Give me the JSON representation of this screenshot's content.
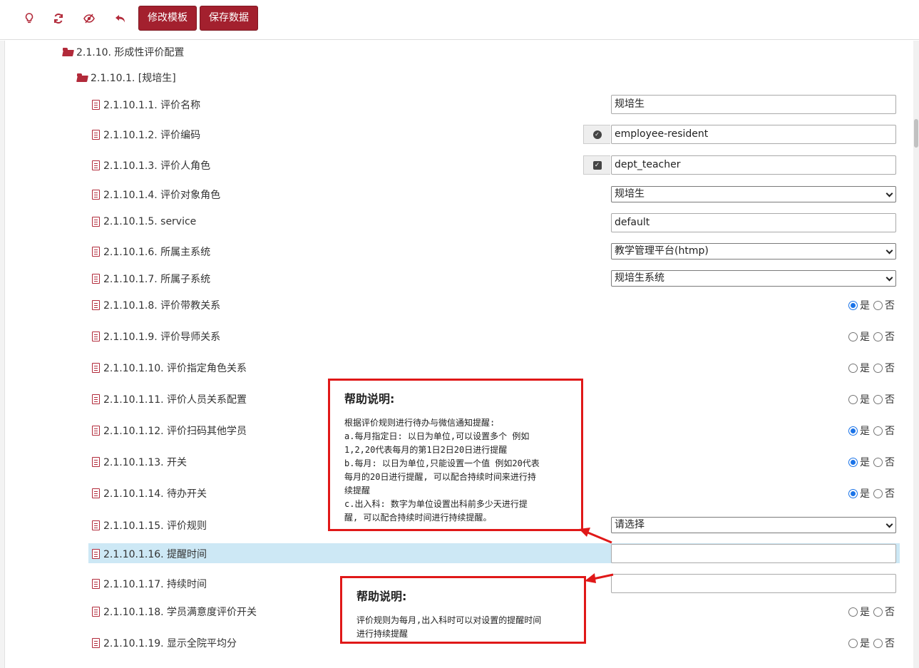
{
  "toolbar": {
    "icons": [
      "bulb-icon",
      "refresh-icon",
      "eye-slash-icon",
      "undo-icon"
    ],
    "edit_template": "修改模板",
    "save_data": "保存数据"
  },
  "tree": {
    "folder1": "2.1.10. 形成性评价配置",
    "folder2": "2.1.10.1. [规培生]"
  },
  "rows": [
    {
      "label": "2.1.10.1.1. 评价名称",
      "type": "input",
      "value": "规培生"
    },
    {
      "label": "2.1.10.1.2. 评价编码",
      "type": "input-addon",
      "addon_icon": "check-circle-icon",
      "value": "employee-resident"
    },
    {
      "label": "2.1.10.1.3. 评价人角色",
      "type": "input-addon",
      "addon_icon": "check-square-icon",
      "value": "dept_teacher"
    },
    {
      "label": "2.1.10.1.4. 评价对象角色",
      "type": "select",
      "value": "规培生"
    },
    {
      "label": "2.1.10.1.5. service",
      "type": "input",
      "value": "default"
    },
    {
      "label": "2.1.10.1.6. 所属主系统",
      "type": "select",
      "value": "教学管理平台(htmp)"
    },
    {
      "label": "2.1.10.1.7. 所属子系统",
      "type": "select",
      "value": "规培生系统"
    },
    {
      "label": "2.1.10.1.8. 评价带教关系",
      "type": "radio",
      "yes": "是",
      "no": "否",
      "selected": "yes"
    },
    {
      "label": "2.1.10.1.9. 评价导师关系",
      "type": "radio",
      "yes": "是",
      "no": "否",
      "selected": "none"
    },
    {
      "label": "2.1.10.1.10. 评价指定角色关系",
      "type": "radio",
      "yes": "是",
      "no": "否",
      "selected": "none"
    },
    {
      "label": "2.1.10.1.11. 评价人员关系配置",
      "type": "radio",
      "yes": "是",
      "no": "否",
      "selected": "none"
    },
    {
      "label": "2.1.10.1.12. 评价扫码其他学员",
      "type": "radio",
      "yes": "是",
      "no": "否",
      "selected": "yes"
    },
    {
      "label": "2.1.10.1.13. 开关",
      "type": "radio",
      "yes": "是",
      "no": "否",
      "selected": "yes"
    },
    {
      "label": "2.1.10.1.14. 待办开关",
      "type": "radio",
      "yes": "是",
      "no": "否",
      "selected": "yes"
    },
    {
      "label": "2.1.10.1.15. 评价规则",
      "type": "select",
      "value": "请选择"
    },
    {
      "label": "2.1.10.1.16. 提醒时间",
      "type": "input",
      "value": ""
    },
    {
      "label": "2.1.10.1.17. 持续时间",
      "type": "input",
      "value": ""
    },
    {
      "label": "2.1.10.1.18. 学员满意度评价开关",
      "type": "radio",
      "yes": "是",
      "no": "否",
      "selected": "none"
    },
    {
      "label": "2.1.10.1.19. 显示全院平均分",
      "type": "radio",
      "yes": "是",
      "no": "否",
      "selected": "none"
    }
  ],
  "help1": {
    "title": "帮助说明:",
    "text": "根据评价规则进行待办与微信通知提醒:\na.每月指定日: 以日为单位,可以设置多个 例如\n1,2,20代表每月的第1日2日20日进行提醒\nb.每月: 以日为单位,只能设置一个值 例如20代表\n每月的20日进行提醒, 可以配合持续时间来进行持\n续提醒\nc.出入科: 数字为单位设置出科前多少天进行提\n醒, 可以配合持续时间进行持续提醒。"
  },
  "help2": {
    "title": "帮助说明:",
    "text": "评价规则为每月,出入科时可以对设置的提醒时间\n进行持续提醒"
  },
  "colors": {
    "accent": "#a3202e",
    "callout": "#e01818",
    "selected_row": "#cde8f5",
    "radio_checked": "#1a73e8"
  }
}
